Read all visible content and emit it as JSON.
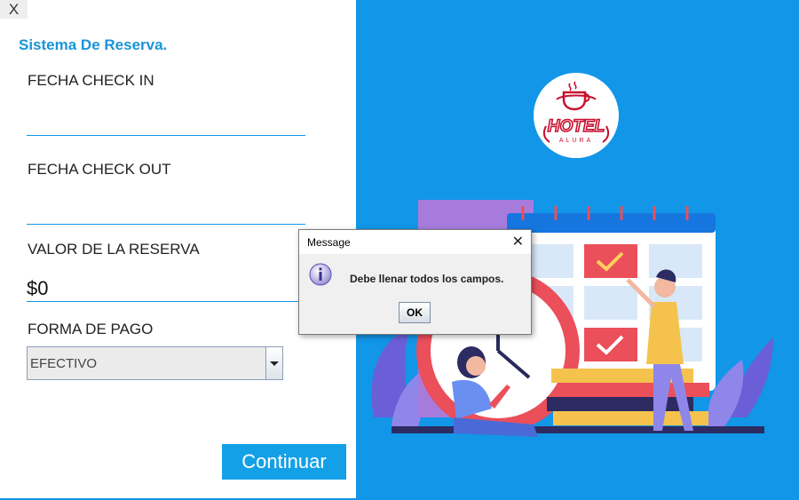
{
  "window": {
    "close_label": "X"
  },
  "form": {
    "title": "Sistema De Reserva.",
    "checkin_label": "FECHA CHECK IN",
    "checkin_value": "",
    "checkout_label": "FECHA CHECK OUT",
    "checkout_value": "",
    "value_label": "VALOR DE LA RESERVA",
    "value": "$0",
    "payment_label": "FORMA DE PAGO",
    "payment_selected": "EFECTIVO",
    "continue_label": "Continuar"
  },
  "brand": {
    "logo_word": "HOTEL",
    "logo_sub": "ALURA"
  },
  "dialog": {
    "title": "Message",
    "close_label": "✕",
    "message": "Debe llenar todos los campos.",
    "ok_label": "OK"
  },
  "colors": {
    "accent": "#1296e8",
    "title_blue": "#1a94d8",
    "logo_red": "#c8102e"
  }
}
